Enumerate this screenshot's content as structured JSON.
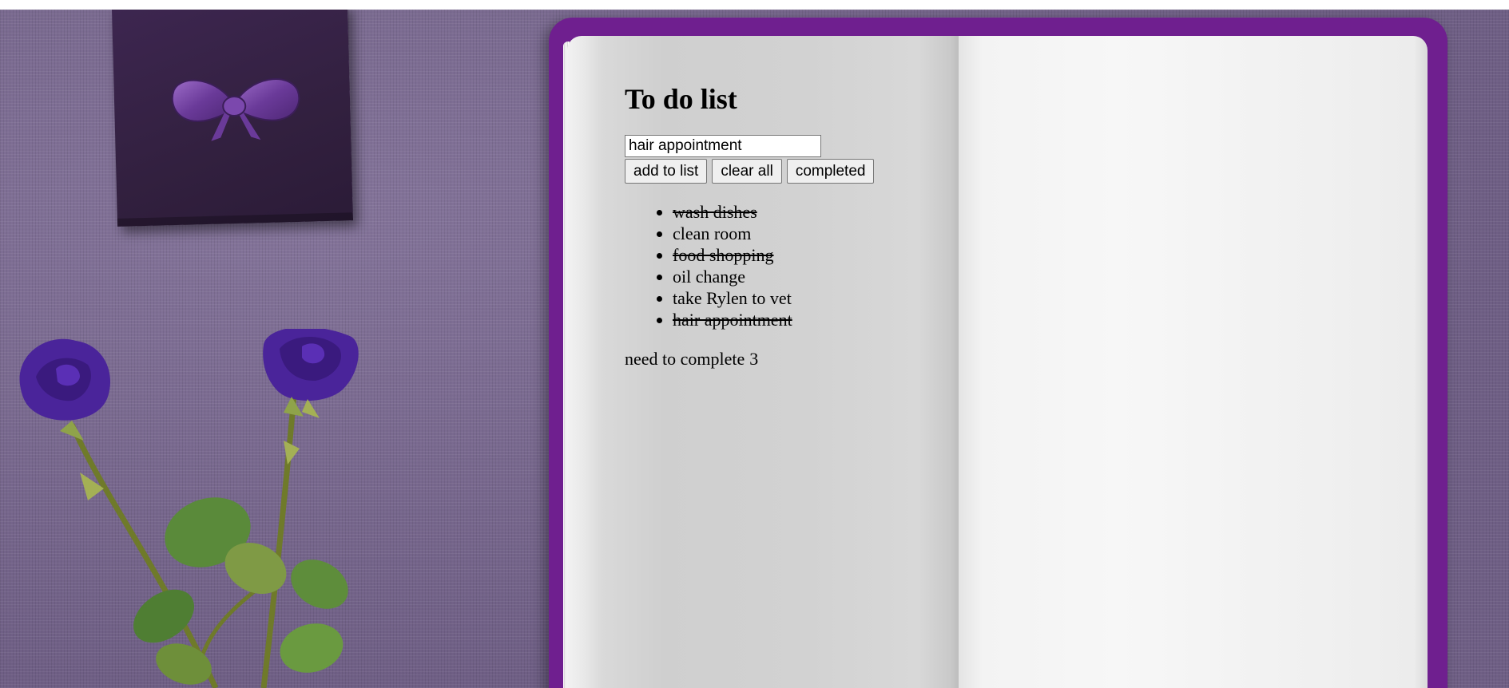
{
  "app": {
    "title": "To do list",
    "input": {
      "value": "hair appointment"
    },
    "buttons": {
      "add": "add to list",
      "clear": "clear all",
      "completed": "completed"
    },
    "items": [
      {
        "text": "wash dishes",
        "completed": true
      },
      {
        "text": "clean room",
        "completed": false
      },
      {
        "text": "food shopping",
        "completed": true
      },
      {
        "text": "oil change",
        "completed": false
      },
      {
        "text": "take Rylen to vet",
        "completed": false
      },
      {
        "text": "hair appointment",
        "completed": true
      }
    ],
    "remaining": {
      "label": "need to complete",
      "count": "3"
    }
  },
  "colors": {
    "background_fabric": "#7a6a8e",
    "notebook_cover": "#6f1f8f",
    "gift_box": "#32203f",
    "rose": "#4a249a",
    "leaf": "#5a8a3a"
  },
  "decor": {
    "gift_box_icon": "gift-box",
    "bow_icon": "bow",
    "rose_icon": "rose"
  }
}
